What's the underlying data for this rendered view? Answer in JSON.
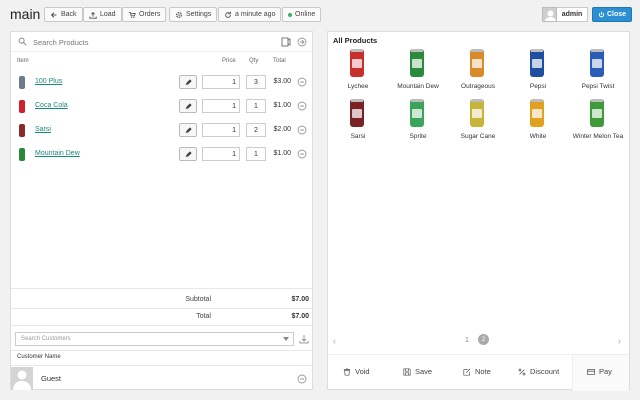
{
  "app": {
    "title": "main"
  },
  "toolbar": {
    "back": "Back",
    "load": "Load",
    "orders": "Orders",
    "settings": "Settings",
    "saved": "a minute ago",
    "status": "Online",
    "user": "admin",
    "close": "Close"
  },
  "cart": {
    "search_placeholder": "Search Products",
    "headers": {
      "item": "Item",
      "price": "Price",
      "qty": "Qty",
      "total": "Total"
    },
    "items": [
      {
        "name": "100 Plus",
        "price": "1",
        "qty": "3",
        "total": "$3.00",
        "color": "#6b7c8c"
      },
      {
        "name": "Coca Cola",
        "price": "1",
        "qty": "1",
        "total": "$1.00",
        "color": "#d0202a"
      },
      {
        "name": "Sarsi",
        "price": "1",
        "qty": "2",
        "total": "$2.00",
        "color": "#8a2a2a"
      },
      {
        "name": "Mountain Dew",
        "price": "1",
        "qty": "1",
        "total": "$1.00",
        "color": "#2a8a3a"
      }
    ],
    "subtotal_label": "Subtotal",
    "subtotal": "$7.00",
    "total_label": "Total",
    "total": "$7.00",
    "customer_search_placeholder": "Search Customers",
    "customer_name_header": "Customer Name",
    "customer": "Guest"
  },
  "products": {
    "title": "All Products",
    "items": [
      {
        "name": "Lychee",
        "color": "#c9302c"
      },
      {
        "name": "Mountain Dew",
        "color": "#2b8a3e"
      },
      {
        "name": "Outrageous",
        "color": "#d98a2b"
      },
      {
        "name": "Pepsi",
        "color": "#1f4fa0"
      },
      {
        "name": "Pepsi Twist",
        "color": "#2a5db8"
      },
      {
        "name": "Sarsi",
        "color": "#7a2326"
      },
      {
        "name": "Sprite",
        "color": "#3aa55a"
      },
      {
        "name": "Sugar Cane",
        "color": "#c7b43a"
      },
      {
        "name": "White",
        "color": "#e0a020"
      },
      {
        "name": "Winter Melon Tea",
        "color": "#3f9a3a"
      }
    ],
    "pages": [
      "1",
      "2"
    ],
    "actions": {
      "void": "Void",
      "save": "Save",
      "note": "Note",
      "discount": "Discount",
      "pay": "Pay"
    }
  },
  "colors": {
    "accent": "#2b8fd1",
    "link": "#1a8a7a",
    "online": "#3bb36a"
  }
}
